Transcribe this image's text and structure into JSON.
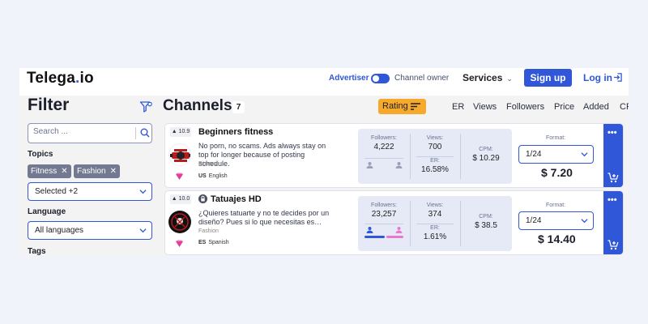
{
  "header": {
    "logo_main": "Telega",
    "logo_dot": ".",
    "logo_end": "io",
    "toggle_left": "Advertiser",
    "toggle_right": "Channel owner",
    "services": "Services",
    "signup": "Sign up",
    "login": "Log in",
    "accent": "#2f57d8"
  },
  "sidebar": {
    "title": "Filter",
    "search_placeholder": "Search ...",
    "topics_label": "Topics",
    "tags": [
      "Fitness",
      "Fashion"
    ],
    "topics_select": "Selected +2",
    "language_label": "Language",
    "language_select": "All languages",
    "tags_label": "Tags"
  },
  "main": {
    "title": "Channels",
    "count": "7",
    "rating_label": "Rating",
    "sort_columns": [
      "ER",
      "Views",
      "Followers",
      "Price",
      "Added",
      "CPM"
    ]
  },
  "cards": [
    {
      "rating": "10.9",
      "name": "Beginners fitness",
      "description": "No porn, no scams. Ads always stay on top for longer because of posting schedule.",
      "topic": "Fitness",
      "lang_code": "US",
      "language": "English",
      "followers_label": "Followers:",
      "followers": "4,222",
      "views_label": "Views:",
      "views": "700",
      "er_label": "ER:",
      "er": "16.58%",
      "cpm_label": "CPM:",
      "cpm": "$ 10.29",
      "format_label": "Format:",
      "format": "1/24",
      "price": "$ 7.20",
      "male_share": 0,
      "female_share": 0
    },
    {
      "rating": "10.0",
      "name": "Tatuajes HD",
      "description": "¿Quieres tatuarte y no te decides por un diseño? Pues si lo que necesitas es…",
      "topic": "Fashion",
      "lang_code": "ES",
      "language": "Spanish",
      "followers_label": "Followers:",
      "followers": "23,257",
      "views_label": "Views:",
      "views": "374",
      "er_label": "ER:",
      "er": "1.61%",
      "cpm_label": "CPM:",
      "cpm": "$ 38.5",
      "format_label": "Format:",
      "format": "1/24",
      "price": "$ 14.40",
      "male_share": 0.55,
      "female_share": 0.45
    }
  ],
  "icons": {
    "rating_icon": "trophy-icon",
    "heart": "heart-icon",
    "cart": "add-to-cart-icon",
    "more": "more-dots-icon",
    "lock": "lock-icon",
    "filter": "filter-icon",
    "search": "search-icon",
    "login": "login-icon"
  },
  "colors": {
    "accent": "#2f57d8",
    "rating_button": "#f7a92b",
    "stats_bg": "#e6eaf7",
    "heart": "#e0409a",
    "male_bar": "#2f57d8",
    "female_bar": "#e77ad0"
  }
}
